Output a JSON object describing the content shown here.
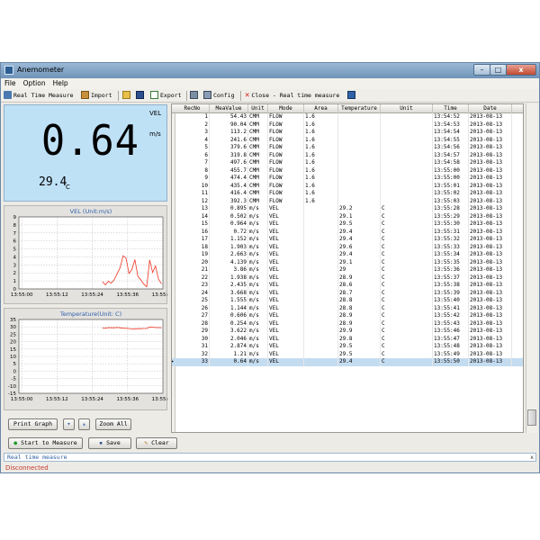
{
  "window": {
    "title": "Anemometer",
    "min": "–",
    "max": "□",
    "close": "x"
  },
  "menu": [
    "File",
    "Option",
    "Help"
  ],
  "toolbar": {
    "real_time": "Real Time Measure",
    "import": "Import",
    "export": "Export",
    "config": "Config",
    "close_rt": "Close - Real time measure"
  },
  "display": {
    "vel_label": "VEL",
    "unit": "m/s",
    "value": "0.64",
    "temp": "29.4",
    "temp_unit": "C"
  },
  "chart_data": [
    {
      "type": "line",
      "title": "VEL (Unit:m/s)",
      "ylim": [
        0,
        9
      ],
      "yticks": [
        "9",
        "8",
        "7",
        "6",
        "5",
        "4",
        "3",
        "2",
        "1",
        "0"
      ],
      "xticks": [
        "13:55:00",
        "13:55:12",
        "13:55:24",
        "13:55:36",
        "13:55:48"
      ],
      "series": [
        {
          "color": "#ee3322",
          "values": [
            0.895,
            0.502,
            0.964,
            0.72,
            1.152,
            1.903,
            2.663,
            4.139,
            3.86,
            1.938,
            2.435,
            3.668,
            1.555,
            1.144,
            0.606,
            0.254,
            3.622,
            2.046,
            2.874,
            1.21,
            0.64
          ]
        }
      ]
    },
    {
      "type": "line",
      "title": "Temperature(Unit: C)",
      "ylim": [
        -15,
        35
      ],
      "yticks": [
        "35",
        "30",
        "25",
        "20",
        "15",
        "10",
        "5",
        "0",
        "-5",
        "-10",
        "-15"
      ],
      "xticks": [
        "13:55:00",
        "13:55:12",
        "13:55:24",
        "13:55:36",
        "13:55:48"
      ],
      "series": [
        {
          "color": "#ee3322",
          "values": [
            29.2,
            29.1,
            29.5,
            29.4,
            29.4,
            29.6,
            29.4,
            29.1,
            29.0,
            28.9,
            28.6,
            28.7,
            28.8,
            28.8,
            28.9,
            28.9,
            29.9,
            29.8,
            29.5,
            29.5,
            29.4
          ]
        }
      ]
    }
  ],
  "buttons": {
    "print_graph": "Print Graph",
    "zoom_all": "Zoom All",
    "start": "Start to Measure",
    "save": "Save",
    "clear": "Clear"
  },
  "grid": {
    "headers": [
      "RecNo",
      "MeaValue",
      "Unit",
      "Mode",
      "Area",
      "Temperature",
      "Unit",
      "Time",
      "Date"
    ],
    "rows": [
      [
        "1",
        "54.43",
        "CMM",
        "FLOW",
        "1.6",
        "",
        "",
        "13:54:52",
        "2013-08-13"
      ],
      [
        "2",
        "90.04",
        "CMM",
        "FLOW",
        "1.6",
        "",
        "",
        "13:54:53",
        "2013-08-13"
      ],
      [
        "3",
        "113.2",
        "CMM",
        "FLOW",
        "1.6",
        "",
        "",
        "13:54:54",
        "2013-08-13"
      ],
      [
        "4",
        "241.6",
        "CMM",
        "FLOW",
        "1.6",
        "",
        "",
        "13:54:55",
        "2013-08-13"
      ],
      [
        "5",
        "379.6",
        "CMM",
        "FLOW",
        "1.6",
        "",
        "",
        "13:54:56",
        "2013-08-13"
      ],
      [
        "6",
        "319.8",
        "CMM",
        "FLOW",
        "1.6",
        "",
        "",
        "13:54:57",
        "2013-08-13"
      ],
      [
        "7",
        "497.6",
        "CMM",
        "FLOW",
        "1.6",
        "",
        "",
        "13:54:58",
        "2013-08-13"
      ],
      [
        "8",
        "455.7",
        "CMM",
        "FLOW",
        "1.6",
        "",
        "",
        "13:55:00",
        "2013-08-13"
      ],
      [
        "9",
        "474.4",
        "CMM",
        "FLOW",
        "1.6",
        "",
        "",
        "13:55:00",
        "2013-08-13"
      ],
      [
        "10",
        "435.4",
        "CMM",
        "FLOW",
        "1.6",
        "",
        "",
        "13:55:01",
        "2013-08-13"
      ],
      [
        "11",
        "416.4",
        "CMM",
        "FLOW",
        "1.6",
        "",
        "",
        "13:55:02",
        "2013-08-13"
      ],
      [
        "12",
        "392.3",
        "CMM",
        "FLOW",
        "1.6",
        "",
        "",
        "13:55:03",
        "2013-08-13"
      ],
      [
        "13",
        "0.895",
        "m/s",
        "VEL",
        "",
        "29.2",
        "C",
        "13:55:28",
        "2013-08-13"
      ],
      [
        "14",
        "0.502",
        "m/s",
        "VEL",
        "",
        "29.1",
        "C",
        "13:55:29",
        "2013-08-13"
      ],
      [
        "15",
        "0.964",
        "m/s",
        "VEL",
        "",
        "29.5",
        "C",
        "13:55:30",
        "2013-08-13"
      ],
      [
        "16",
        "0.72",
        "m/s",
        "VEL",
        "",
        "29.4",
        "C",
        "13:55:31",
        "2013-08-13"
      ],
      [
        "17",
        "1.152",
        "m/s",
        "VEL",
        "",
        "29.4",
        "C",
        "13:55:32",
        "2013-08-13"
      ],
      [
        "18",
        "1.903",
        "m/s",
        "VEL",
        "",
        "29.6",
        "C",
        "13:55:33",
        "2013-08-13"
      ],
      [
        "19",
        "2.663",
        "m/s",
        "VEL",
        "",
        "29.4",
        "C",
        "13:55:34",
        "2013-08-13"
      ],
      [
        "20",
        "4.139",
        "m/s",
        "VEL",
        "",
        "29.1",
        "C",
        "13:55:35",
        "2013-08-13"
      ],
      [
        "21",
        "3.86",
        "m/s",
        "VEL",
        "",
        "29",
        "C",
        "13:55:36",
        "2013-08-13"
      ],
      [
        "22",
        "1.938",
        "m/s",
        "VEL",
        "",
        "28.9",
        "C",
        "13:55:37",
        "2013-08-13"
      ],
      [
        "23",
        "2.435",
        "m/s",
        "VEL",
        "",
        "28.6",
        "C",
        "13:55:38",
        "2013-08-13"
      ],
      [
        "24",
        "3.668",
        "m/s",
        "VEL",
        "",
        "28.7",
        "C",
        "13:55:39",
        "2013-08-13"
      ],
      [
        "25",
        "1.555",
        "m/s",
        "VEL",
        "",
        "28.8",
        "C",
        "13:55:40",
        "2013-08-13"
      ],
      [
        "26",
        "1.144",
        "m/s",
        "VEL",
        "",
        "28.8",
        "C",
        "13:55:41",
        "2013-08-13"
      ],
      [
        "27",
        "0.606",
        "m/s",
        "VEL",
        "",
        "28.9",
        "C",
        "13:55:42",
        "2013-08-13"
      ],
      [
        "28",
        "0.254",
        "m/s",
        "VEL",
        "",
        "28.9",
        "C",
        "13:55:43",
        "2013-08-13"
      ],
      [
        "29",
        "3.622",
        "m/s",
        "VEL",
        "",
        "29.9",
        "C",
        "13:55:46",
        "2013-08-13"
      ],
      [
        "30",
        "2.046",
        "m/s",
        "VEL",
        "",
        "29.8",
        "C",
        "13:55:47",
        "2013-08-13"
      ],
      [
        "31",
        "2.874",
        "m/s",
        "VEL",
        "",
        "29.5",
        "C",
        "13:55:48",
        "2013-08-13"
      ],
      [
        "32",
        "1.21",
        "m/s",
        "VEL",
        "",
        "29.5",
        "C",
        "13:55:49",
        "2013-08-13"
      ],
      [
        "33",
        "0.64",
        "m/s",
        "VEL",
        "",
        "29.4",
        "C",
        "13:55:50",
        "2013-08-13"
      ]
    ],
    "selected_row": 32
  },
  "status": {
    "text": "Real time measure",
    "close": "x",
    "connection": "Disconnected"
  }
}
